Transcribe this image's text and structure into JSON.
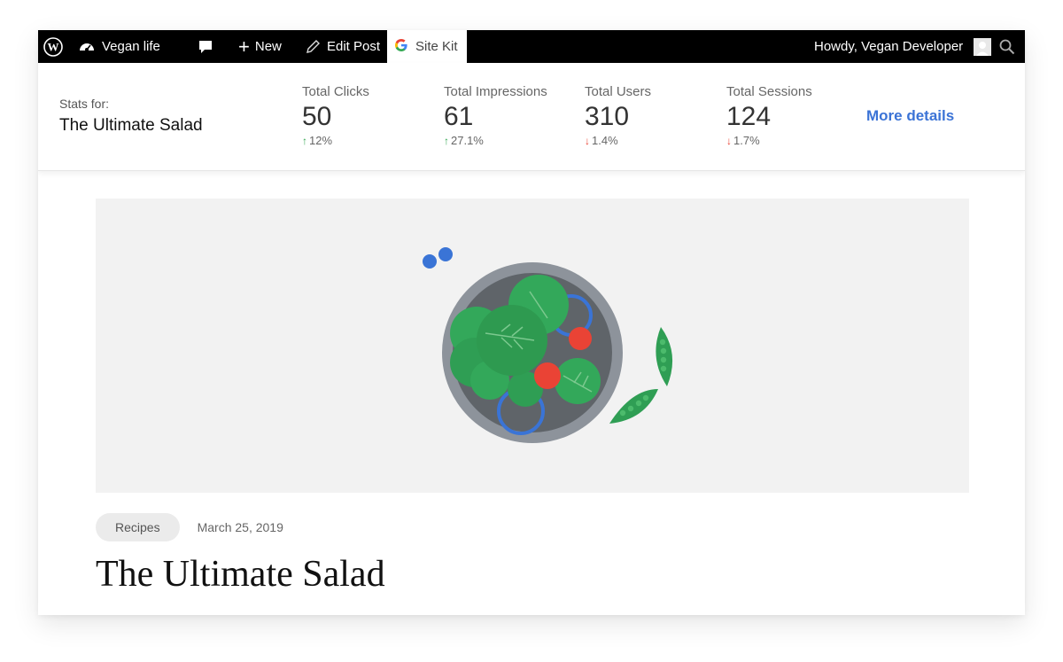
{
  "adminbar": {
    "site_name": "Vegan life",
    "new_label": "New",
    "edit_post_label": "Edit Post",
    "sitekit_label": "Site Kit",
    "greeting": "Howdy, Vegan Developer",
    "icons": {
      "wordpress": "wordpress-logo-icon",
      "dashboard": "dashboard-gauge-icon",
      "comments": "comment-bubble-icon",
      "new": "plus-icon",
      "edit": "pencil-icon",
      "sitekit": "google-g-icon",
      "avatar": "avatar",
      "search": "search-icon"
    }
  },
  "stats": {
    "label": "Stats for:",
    "title": "The Ultimate Salad",
    "metrics": [
      {
        "label": "Total Clicks",
        "value": "50",
        "direction": "up",
        "arrow": "↑",
        "change": "12%"
      },
      {
        "label": "Total Impressions",
        "value": "61",
        "direction": "up",
        "arrow": "↑",
        "change": "27.1%"
      },
      {
        "label": "Total Users",
        "value": "310",
        "direction": "down",
        "arrow": "↓",
        "change": "1.4%"
      },
      {
        "label": "Total Sessions",
        "value": "124",
        "direction": "down",
        "arrow": "↓",
        "change": "1.7%"
      }
    ],
    "more_details": "More details"
  },
  "post": {
    "category": "Recipes",
    "date": "March 25, 2019",
    "title": "The Ultimate Salad"
  },
  "colors": {
    "adminbar_bg": "#000000",
    "link_blue": "#3b73d6",
    "up_green": "#34a853",
    "down_red": "#ea4335",
    "hero_bg": "#f2f2f2"
  }
}
